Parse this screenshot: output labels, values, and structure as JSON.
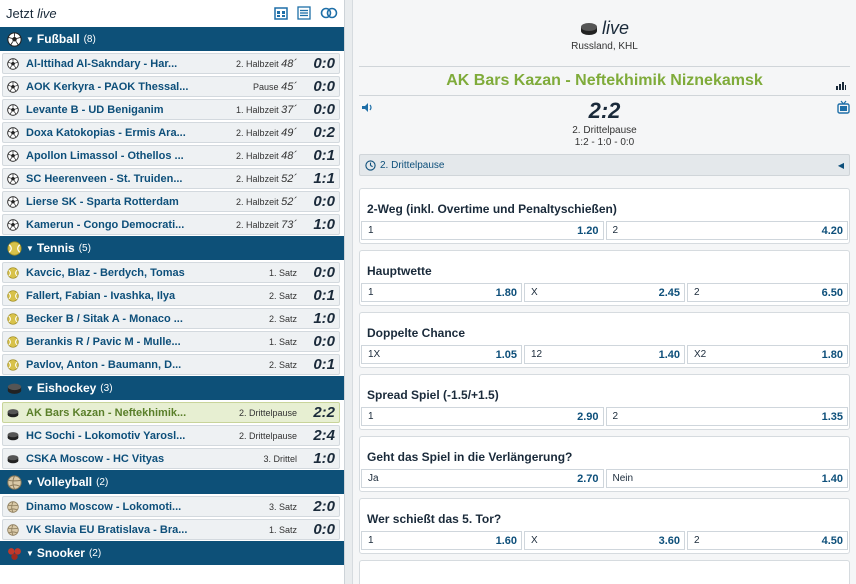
{
  "left_panel": {
    "title_prefix": "Jetzt",
    "title_live": "live",
    "sports": [
      {
        "name": "Fußball",
        "count": "(8)",
        "icon": "soccer-ball-icon",
        "matches": [
          {
            "name": "Al-Ittihad Al-Sakndary - Har...",
            "status": "2. Halbzeit",
            "minute": "48´",
            "score": "0:0"
          },
          {
            "name": "AOK Kerkyra - PAOK Thessal...",
            "status": "Pause",
            "minute": "45´",
            "score": "0:0"
          },
          {
            "name": "Levante B - UD Beniganim",
            "status": "1. Halbzeit",
            "minute": "37´",
            "score": "0:0"
          },
          {
            "name": "Doxa Katokopias - Ermis Ara...",
            "status": "2. Halbzeit",
            "minute": "49´",
            "score": "0:2"
          },
          {
            "name": "Apollon Limassol - Othellos ...",
            "status": "2. Halbzeit",
            "minute": "48´",
            "score": "0:1"
          },
          {
            "name": "SC Heerenveen - St. Truiden...",
            "status": "2. Halbzeit",
            "minute": "52´",
            "score": "1:1"
          },
          {
            "name": "Lierse SK - Sparta Rotterdam",
            "status": "2. Halbzeit",
            "minute": "52´",
            "score": "0:0"
          },
          {
            "name": "Kamerun - Congo Democrati...",
            "status": "2. Halbzeit",
            "minute": "73´",
            "score": "1:0"
          }
        ]
      },
      {
        "name": "Tennis",
        "count": "(5)",
        "icon": "tennis-ball-icon",
        "matches": [
          {
            "name": "Kavcic, Blaz - Berdych, Tomas",
            "status": "1. Satz",
            "minute": "",
            "score": "0:0"
          },
          {
            "name": "Fallert, Fabian - Ivashka, Ilya",
            "status": "2. Satz",
            "minute": "",
            "score": "0:1"
          },
          {
            "name": "Becker B / Sitak A - Monaco ...",
            "status": "2. Satz",
            "minute": "",
            "score": "1:0"
          },
          {
            "name": "Berankis R / Pavic M - Mulle...",
            "status": "1. Satz",
            "minute": "",
            "score": "0:0"
          },
          {
            "name": "Pavlov, Anton - Baumann, D...",
            "status": "2. Satz",
            "minute": "",
            "score": "0:1"
          }
        ]
      },
      {
        "name": "Eishockey",
        "count": "(3)",
        "icon": "hockey-puck-icon",
        "matches": [
          {
            "name": "AK Bars Kazan - Neftekhimik...",
            "status": "2. Drittelpause",
            "minute": "",
            "score": "2:2",
            "active": true
          },
          {
            "name": "HC Sochi - Lokomotiv Yarosl...",
            "status": "2. Drittelpause",
            "minute": "",
            "score": "2:4"
          },
          {
            "name": "CSKA Moscow - HC Vityas",
            "status": "3. Drittel",
            "minute": "",
            "score": "1:0"
          }
        ]
      },
      {
        "name": "Volleyball",
        "count": "(2)",
        "icon": "volleyball-icon",
        "matches": [
          {
            "name": "Dinamo Moscow - Lokomoti...",
            "status": "3. Satz",
            "minute": "",
            "score": "2:0"
          },
          {
            "name": "VK Slavia EU Bratislava - Bra...",
            "status": "1. Satz",
            "minute": "",
            "score": "0:0"
          }
        ]
      },
      {
        "name": "Snooker",
        "count": "(2)",
        "icon": "snooker-icon",
        "matches": []
      }
    ]
  },
  "event": {
    "live_label": "live",
    "league": "Russland, KHL",
    "title": "AK Bars Kazan - Neftekhimik Niznekamsk",
    "score": "2:2",
    "period": "2. Drittelpause",
    "period_scores": "1:2 - 1:0 - 0:0",
    "status_bar": "2. Drittelpause"
  },
  "markets": [
    {
      "title": "2-Weg (inkl. Overtime und Penaltyschießen)",
      "outcomes": [
        {
          "label": "1",
          "odds": "1.20"
        },
        {
          "label": "2",
          "odds": "4.20"
        }
      ]
    },
    {
      "title": "Hauptwette",
      "outcomes": [
        {
          "label": "1",
          "odds": "1.80"
        },
        {
          "label": "X",
          "odds": "2.45"
        },
        {
          "label": "2",
          "odds": "6.50"
        }
      ]
    },
    {
      "title": "Doppelte Chance",
      "outcomes": [
        {
          "label": "1X",
          "odds": "1.05"
        },
        {
          "label": "12",
          "odds": "1.40"
        },
        {
          "label": "X2",
          "odds": "1.80"
        }
      ]
    },
    {
      "title": "Spread Spiel (-1.5/+1.5)",
      "outcomes": [
        {
          "label": "1",
          "odds": "2.90"
        },
        {
          "label": "2",
          "odds": "1.35"
        }
      ]
    },
    {
      "title": "Geht das Spiel in die Verlängerung?",
      "outcomes": [
        {
          "label": "Ja",
          "odds": "2.70"
        },
        {
          "label": "Nein",
          "odds": "1.40"
        }
      ]
    },
    {
      "title": "Wer schießt das 5. Tor?",
      "outcomes": [
        {
          "label": "1",
          "odds": "1.60"
        },
        {
          "label": "X",
          "odds": "3.60"
        },
        {
          "label": "2",
          "odds": "4.50"
        }
      ]
    }
  ],
  "colors": {
    "sport_header": "#0d5078",
    "team_link": "#0d4f7a",
    "event_title": "#7fab3a",
    "active_row": "#e7efd2"
  }
}
